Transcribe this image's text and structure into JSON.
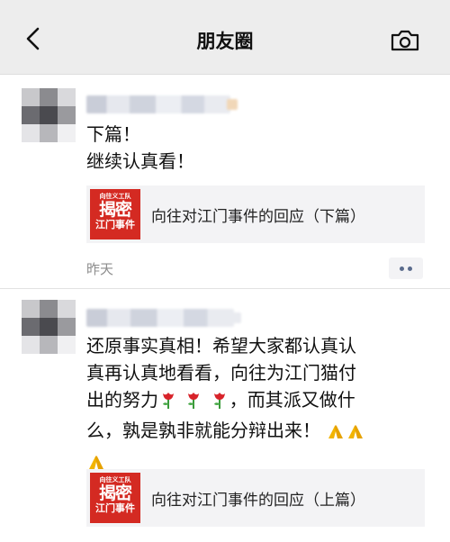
{
  "header": {
    "title": "朋友圈"
  },
  "posts": [
    {
      "text": "下篇！\n继续认真看！",
      "link": {
        "title": "向往对江门事件的回应（下篇）",
        "thumb_line1": "向往义工队",
        "thumb_line2": "揭密",
        "thumb_line3": "江门事件"
      },
      "time": "昨天"
    },
    {
      "text_a": "还原事实真相！希望大家都认真认\n真再认真地看看，向往为江门猫付\n出的努力",
      "text_b": "，而其派又做什\n么，孰是孰非就能分辩出来！",
      "link": {
        "title": "向往对江门事件的回应（上篇）",
        "thumb_line1": "向往义工队",
        "thumb_line2": "揭密",
        "thumb_line3": "江门事件"
      }
    }
  ],
  "colors": {
    "nav_bg": "#ededed",
    "thumb_red": "#d42a22",
    "more_dots": "#5a6b8c"
  },
  "icons": {
    "back": "chevron-left-icon",
    "camera": "camera-icon",
    "rose": "rose-emoji",
    "pray": "folded-hands-emoji"
  }
}
